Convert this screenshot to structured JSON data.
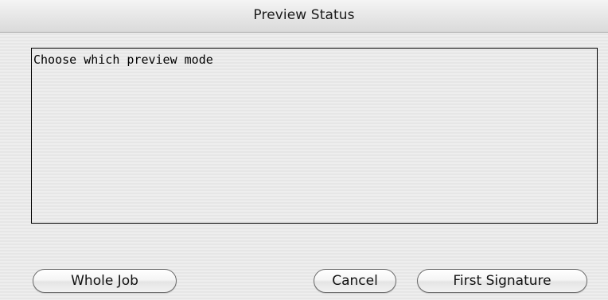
{
  "window": {
    "title": "Preview Status"
  },
  "message": {
    "text": "Choose which preview mode"
  },
  "buttons": {
    "whole_job": "Whole Job",
    "cancel": "Cancel",
    "first_signature": "First Signature"
  }
}
